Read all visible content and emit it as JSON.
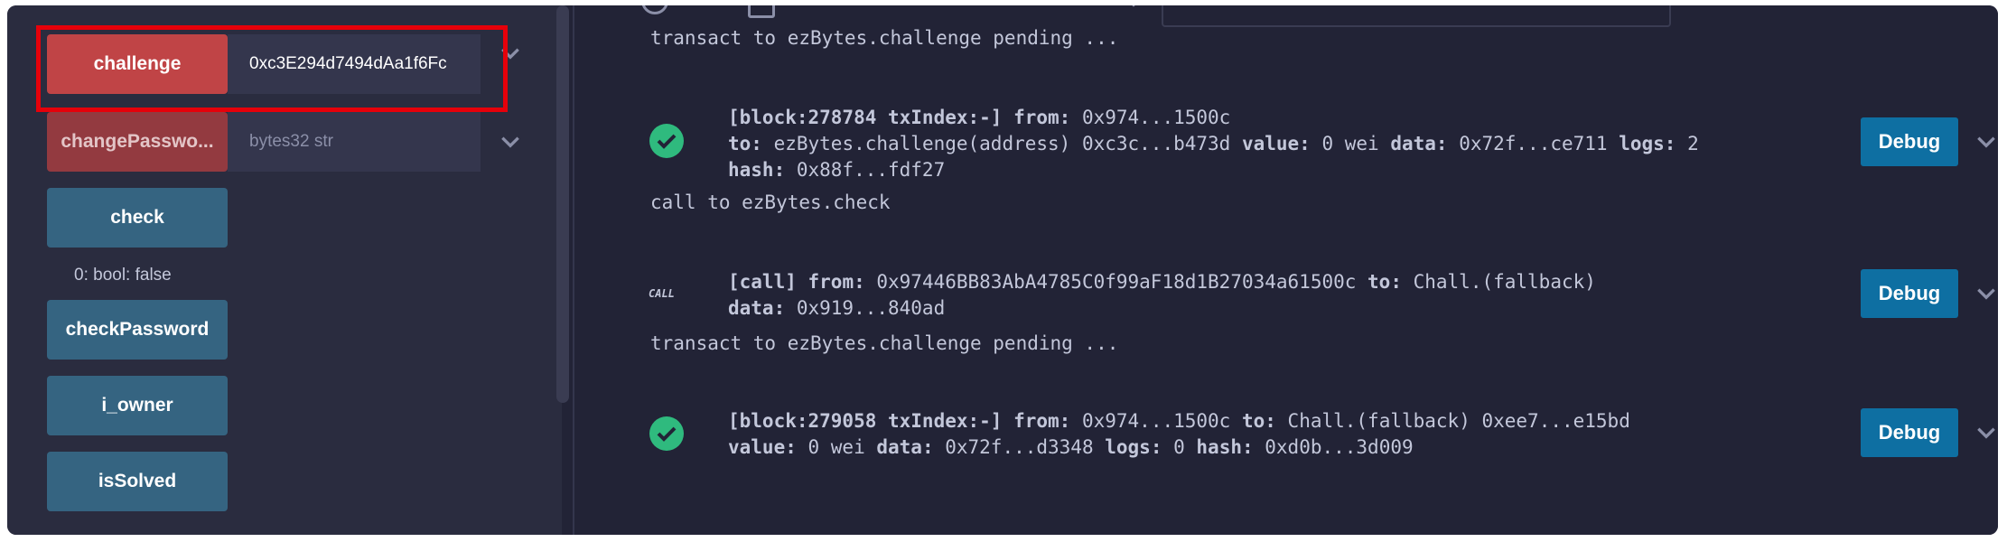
{
  "left_panel": {
    "functions": [
      {
        "label": "challenge",
        "input_value": "0xc3E294d7494dAa1f6Fc",
        "input_placeholder": "",
        "style": "red"
      },
      {
        "label": "changePasswo...",
        "input_value": "",
        "input_placeholder": "bytes32 str",
        "style": "red-dim"
      },
      {
        "label": "check",
        "style": "blue"
      },
      {
        "label": "checkPassword",
        "style": "blue"
      },
      {
        "label": "i_owner",
        "style": "blue"
      },
      {
        "label": "isSolved",
        "style": "blue"
      }
    ],
    "check_result": "0: bool: false"
  },
  "terminal": {
    "lines": [
      "transact to ezBytes.challenge pending ...",
      "call to ezBytes.check",
      "transact to ezBytes.challenge pending ..."
    ],
    "entries": [
      {
        "status": "success",
        "debug_label": "Debug",
        "rows": [
          [
            {
              "k": "[block:278784 txIndex:-]"
            },
            {
              "t": " "
            },
            {
              "k": "from:"
            },
            {
              "t": " 0x974...1500c"
            }
          ],
          [
            {
              "k": "to:"
            },
            {
              "t": " ezBytes.challenge(address) 0xc3c...b473d "
            },
            {
              "k": "value:"
            },
            {
              "t": " 0 wei "
            },
            {
              "k": "data:"
            },
            {
              "t": " 0x72f...ce711 "
            },
            {
              "k": "logs:"
            },
            {
              "t": " 2"
            }
          ],
          [
            {
              "k": "hash:"
            },
            {
              "t": " 0x88f...fdf27"
            }
          ]
        ]
      },
      {
        "status": "call",
        "status_label": "CALL",
        "debug_label": "Debug",
        "rows": [
          [
            {
              "k": "[call]"
            },
            {
              "t": " "
            },
            {
              "k": "from:"
            },
            {
              "t": " 0x97446BB83AbA4785C0f99aF18d1B27034a61500c "
            },
            {
              "k": "to:"
            },
            {
              "t": " Chall.(fallback)"
            }
          ],
          [
            {
              "k": "data:"
            },
            {
              "t": " 0x919...840ad"
            }
          ]
        ]
      },
      {
        "status": "success",
        "debug_label": "Debug",
        "rows": [
          [
            {
              "k": "[block:279058 txIndex:-]"
            },
            {
              "t": " "
            },
            {
              "k": "from:"
            },
            {
              "t": " 0x974...1500c "
            },
            {
              "k": "to:"
            },
            {
              "t": " Chall.(fallback) 0xee7...e15bd"
            }
          ],
          [
            {
              "k": "value:"
            },
            {
              "t": " 0 wei "
            },
            {
              "k": "data:"
            },
            {
              "t": " 0x72f...d3348 "
            },
            {
              "k": "logs:"
            },
            {
              "t": " 0 "
            },
            {
              "k": "hash:"
            },
            {
              "t": " 0xd0b...3d009"
            }
          ]
        ]
      }
    ]
  },
  "colors": {
    "success": "#2fba7e",
    "debug": "#0e6fa2",
    "highlight": "#e6000a"
  },
  "icons": {
    "success": "check-circle-icon",
    "expand": "chevron-down-icon"
  }
}
